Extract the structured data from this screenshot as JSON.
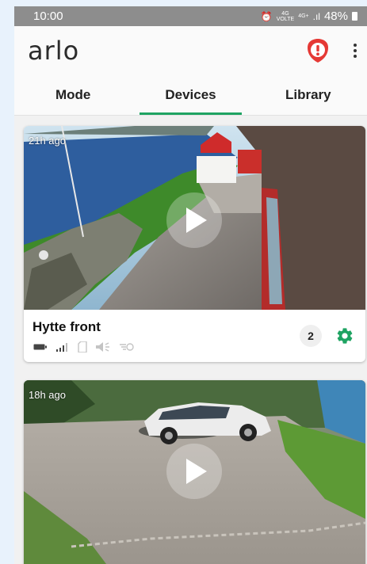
{
  "status_bar": {
    "time": "10:00",
    "network_4g_top": "4G",
    "network_4g_bottom": "VOLTE",
    "network_4g_plus": "4G+",
    "battery_percent": "48%"
  },
  "app": {
    "logo": "arlo",
    "brand_color": "#1ea362",
    "alert_color": "#e53935"
  },
  "tabs": [
    {
      "label": "Mode",
      "active": false
    },
    {
      "label": "Devices",
      "active": true
    },
    {
      "label": "Library",
      "active": false
    }
  ],
  "devices": [
    {
      "name": "Hytte front",
      "last_seen": "21h ago",
      "recordings_count": "2",
      "status_icons": [
        "battery-icon",
        "signal-icon",
        "sd-card-icon",
        "speaker-icon",
        "motion-icon"
      ]
    },
    {
      "name": "",
      "last_seen": "18h ago"
    }
  ]
}
